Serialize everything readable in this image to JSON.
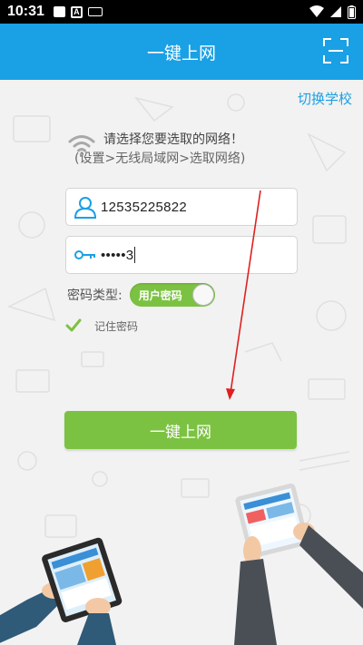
{
  "status_bar": {
    "time": "10:31",
    "icons": [
      "image-icon",
      "a-icon",
      "keyboard-icon",
      "wifi-icon",
      "signal-icon",
      "battery-icon"
    ]
  },
  "app_bar": {
    "title": "一键上网",
    "scan_icon": "scan-icon"
  },
  "switch_school": "切换学校",
  "hint": {
    "line1": "请选择您要选取的网络！",
    "line2": "(设置>无线局域网>选取网络)"
  },
  "username": {
    "value": "12535225822",
    "icon": "user-icon"
  },
  "password": {
    "value": "•••••3",
    "icon": "key-icon"
  },
  "password_type": {
    "label": "密码类型:",
    "toggle_label": "用户密码"
  },
  "remember": {
    "label": "记住密码",
    "checked": true
  },
  "connect_button": "一键上网",
  "colors": {
    "primary": "#1aa0e4",
    "accent_green": "#7cc242",
    "arrow_red": "#e02020"
  }
}
